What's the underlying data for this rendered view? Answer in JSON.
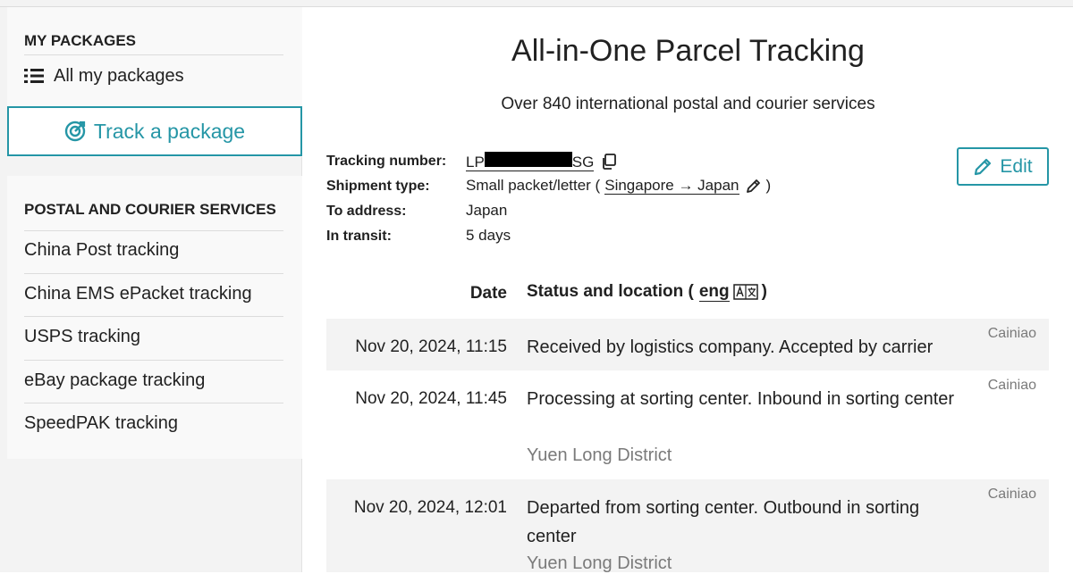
{
  "sidebar": {
    "my_packages_title": "MY PACKAGES",
    "all_packages_label": "All my packages",
    "track_button_label": "Track a package",
    "services_title": "POSTAL AND COURIER SERVICES",
    "services": [
      "China Post tracking",
      "China EMS ePacket tracking",
      "USPS tracking",
      "eBay package tracking",
      "SpeedPAK tracking"
    ]
  },
  "main": {
    "title": "All-in-One Parcel Tracking",
    "subtitle": "Over 840 international postal and courier services",
    "edit_label": "Edit",
    "info": {
      "tracking_label": "Tracking number:",
      "tracking_prefix": "LP",
      "tracking_suffix": "SG",
      "shipment_label": "Shipment type:",
      "shipment_value": "Small packet/letter (",
      "route": "Singapore → Japan",
      "shipment_close": ")",
      "address_label": "To address:",
      "address_value": "Japan",
      "transit_label": "In transit:",
      "transit_value": "5 days"
    },
    "columns": {
      "date": "Date",
      "status": "Status and location (",
      "lang": "eng",
      "close": ")"
    },
    "events": [
      {
        "date": "Nov 20, 2024, 11:15",
        "status": "Received by logistics company. Accepted by carrier",
        "location": "",
        "carrier": "Cainiao"
      },
      {
        "date": "Nov 20, 2024, 11:45",
        "status": "Processing at sorting center. Inbound in sorting center",
        "location": "Yuen Long District",
        "carrier": "Cainiao"
      },
      {
        "date": "Nov 20, 2024, 12:01",
        "status": "Departed from sorting center. Outbound in sorting center",
        "location": "Yuen Long District",
        "carrier": "Cainiao"
      }
    ]
  },
  "colors": {
    "accent": "#2596a6",
    "muted_text": "#7a7a7a",
    "row_shade": "#f3f3f3"
  },
  "icons": [
    "list-icon",
    "target-icon",
    "copy-icon",
    "pencil-icon",
    "edit-icon",
    "translate-icon"
  ]
}
